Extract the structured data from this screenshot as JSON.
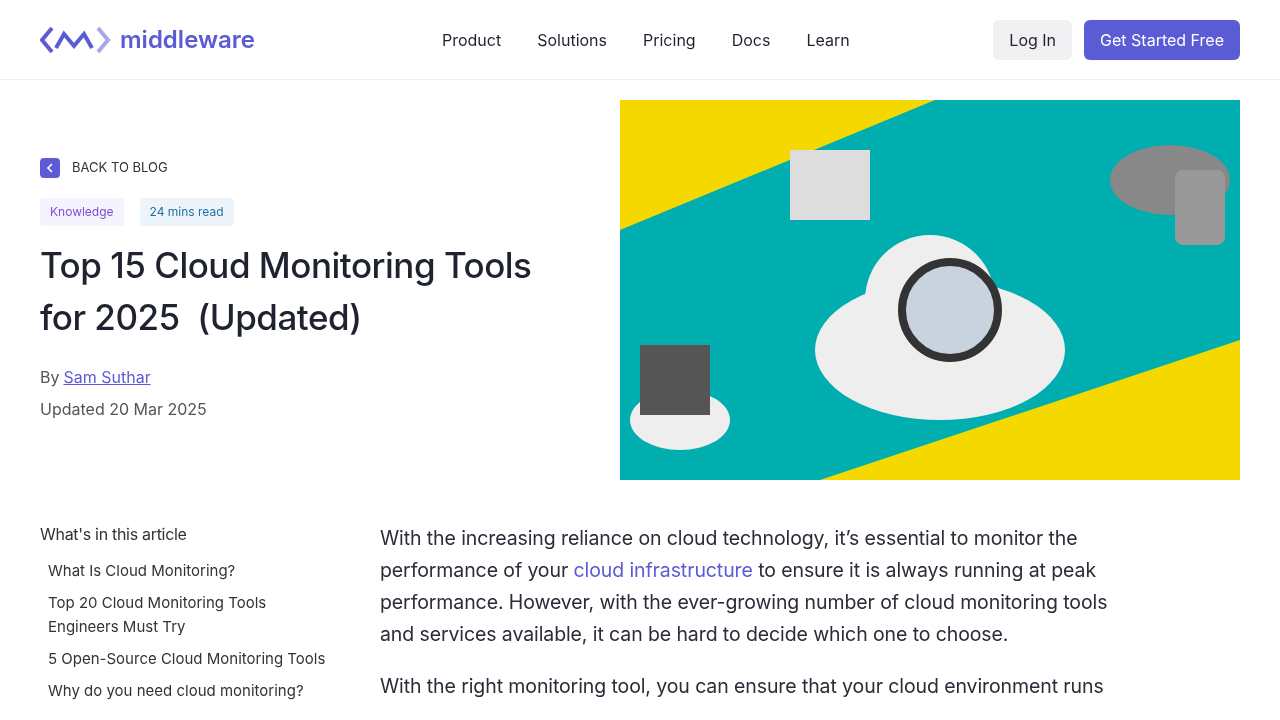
{
  "header": {
    "logo": "middleware",
    "nav": [
      "Product",
      "Solutions",
      "Pricing",
      "Docs",
      "Learn"
    ],
    "login": "Log In",
    "cta": "Get Started Free"
  },
  "article": {
    "back": "BACK TO BLOG",
    "tags": [
      {
        "label": "Knowledge",
        "kind": "category"
      },
      {
        "label": "24 mins read",
        "kind": "time"
      }
    ],
    "title_lines": [
      "Top 15 Cloud Monitoring Tools",
      "for 2025  (Updated)"
    ],
    "by": "By",
    "author": "Sam Suthar",
    "updated": "Updated 20 Mar 2025"
  },
  "toc": {
    "heading": "What's in this article",
    "items": [
      "What Is Cloud Monitoring?",
      "Top 20  Cloud Monitoring Tools Engineers Must Try",
      "5 Open-Source Cloud Monitoring Tools",
      "Why do you need cloud monitoring?"
    ]
  },
  "body": [
    {
      "before": "With the increasing reliance on cloud technology, it’s essential to monitor the performance of your ",
      "link": "cloud infrastructure",
      "after": " to ensure it is always running at peak performance. However, with the ever-growing number of cloud monitoring tools and services available, it can be hard to decide which one to choose."
    },
    {
      "before": "With the right monitoring tool, you can ensure that your cloud environment runs"
    }
  ]
}
